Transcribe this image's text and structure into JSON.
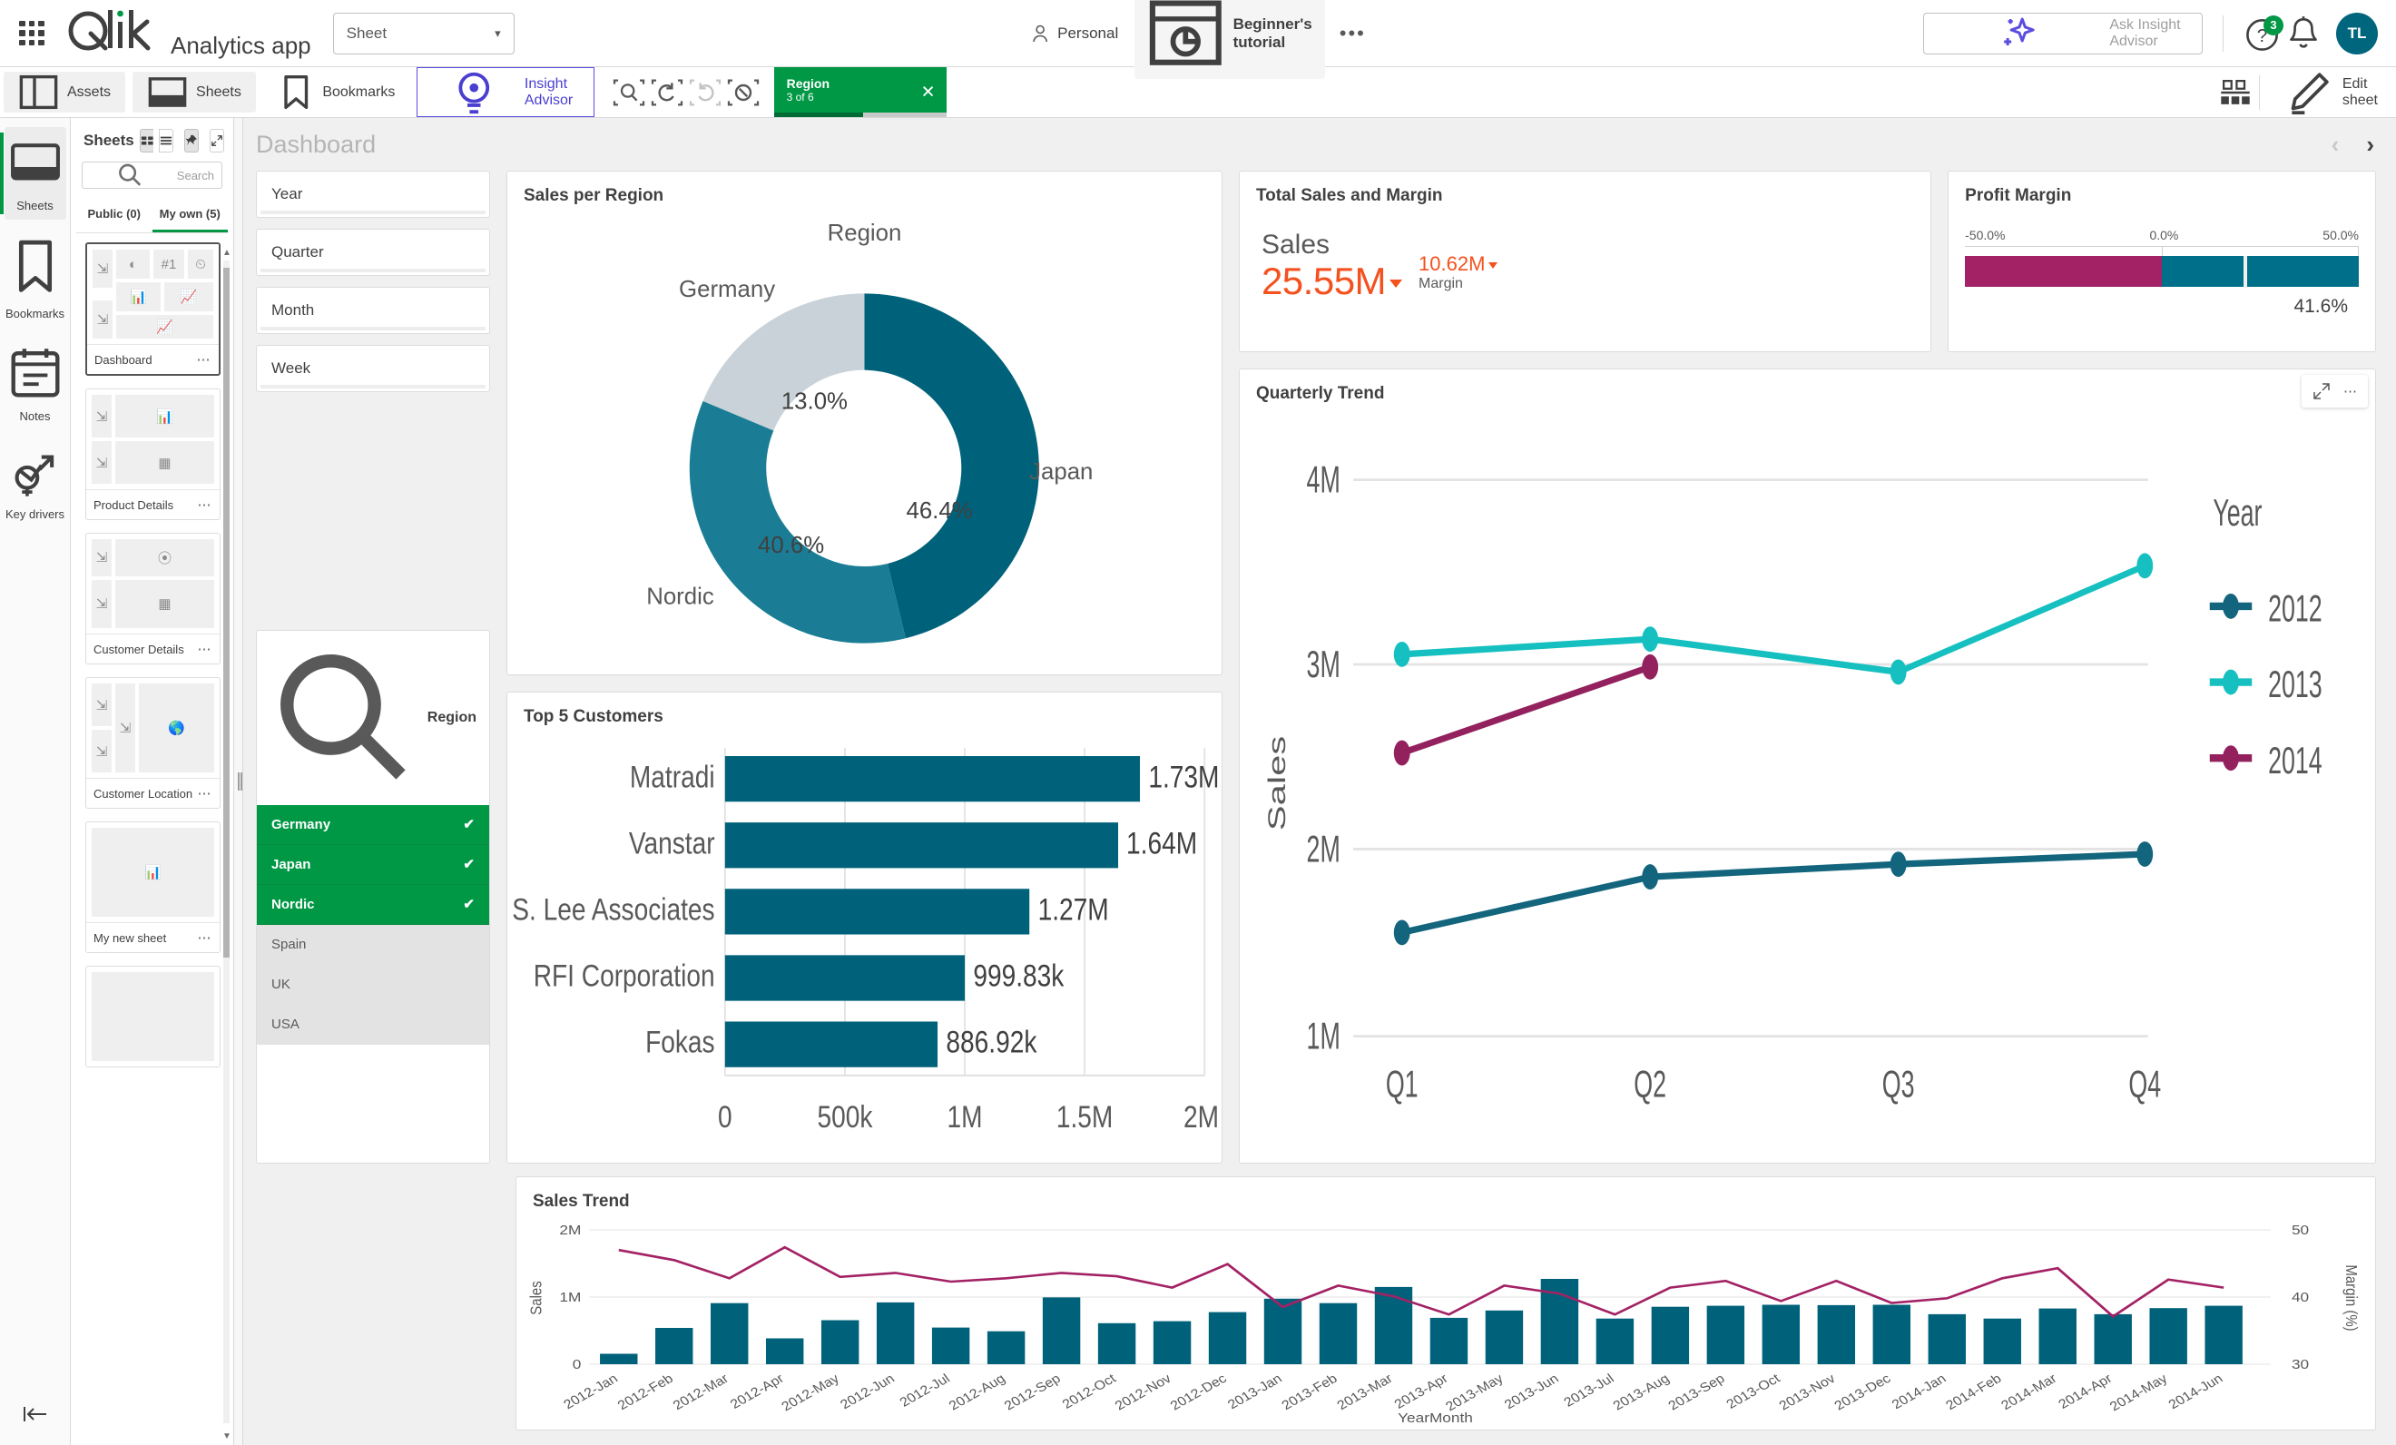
{
  "topbar": {
    "waffle_icon": "apps-grid-icon",
    "logo_text": "Qlik",
    "app_title": "Analytics app",
    "sheet_selector_value": "Sheet",
    "space_label": "Personal",
    "app_name": "Beginner's tutorial",
    "more_label": "•••",
    "insight_placeholder": "Ask Insight Advisor",
    "help_badge": "3",
    "avatar_initials": "TL"
  },
  "toolbar": {
    "assets": "Assets",
    "sheets": "Sheets",
    "bookmarks": "Bookmarks",
    "insight_advisor": "Insight Advisor",
    "selection_chip": {
      "field": "Region",
      "state": "3 of 6",
      "close": "✕"
    },
    "edit_sheet": "Edit sheet"
  },
  "rail": {
    "items": [
      {
        "label": "Sheets",
        "icon": "sheet-icon",
        "active": true
      },
      {
        "label": "Bookmarks",
        "icon": "bookmark-icon",
        "active": false
      },
      {
        "label": "Notes",
        "icon": "notes-icon",
        "active": false
      },
      {
        "label": "Key drivers",
        "icon": "key-drivers-icon",
        "active": false
      }
    ],
    "collapse_label": "collapse-panel-icon"
  },
  "sheets_panel": {
    "title": "Sheets",
    "search_placeholder": "Search",
    "tabs": [
      {
        "label": "Public (0)",
        "active": false
      },
      {
        "label": "My own (5)",
        "active": true
      }
    ],
    "sheets": [
      {
        "name": "Dashboard",
        "selected": true
      },
      {
        "name": "Product Details",
        "selected": false
      },
      {
        "name": "Customer Details",
        "selected": false
      },
      {
        "name": "Customer Location",
        "selected": false
      },
      {
        "name": "My new sheet",
        "selected": false
      }
    ]
  },
  "sheet": {
    "name": "Dashboard",
    "prev_arrow": "‹",
    "next_arrow": "›"
  },
  "filters": {
    "items": [
      "Year",
      "Quarter",
      "Month",
      "Week"
    ],
    "listbox": {
      "field": "Region",
      "values": [
        {
          "label": "Germany",
          "selected": true,
          "check": "✔"
        },
        {
          "label": "Japan",
          "selected": true,
          "check": "✔"
        },
        {
          "label": "Nordic",
          "selected": true,
          "check": "✔"
        },
        {
          "label": "Spain",
          "selected": false,
          "check": ""
        },
        {
          "label": "UK",
          "selected": false,
          "check": ""
        },
        {
          "label": "USA",
          "selected": false,
          "check": ""
        }
      ]
    }
  },
  "cards": {
    "sales_per_region": "Sales per Region",
    "total_sales_margin": "Total Sales and Margin",
    "profit_margin": "Profit Margin",
    "quarterly_trend": "Quarterly Trend",
    "top5": "Top 5 Customers",
    "sales_trend": "Sales Trend"
  },
  "kpi": {
    "title": "Total Sales and Margin",
    "measure_label": "Sales",
    "value": "25.55M",
    "secondary_value": "10.62M",
    "secondary_label": "Margin"
  },
  "gauge": {
    "title": "Profit Margin",
    "min_label": "-50.0%",
    "mid_label": "0.0%",
    "max_label": "50.0%",
    "value_label": "41.6%",
    "value": 41.6,
    "min": -50,
    "max": 50,
    "neg_color": "#a32265",
    "pos_color": "#00708a"
  },
  "chart_data": [
    {
      "id": "sales_per_region",
      "type": "pie",
      "title": "Sales per Region",
      "legend_title": "Region",
      "labels": [
        "Japan",
        "Nordic",
        "Germany"
      ],
      "values": [
        46.4,
        40.6,
        13.0
      ],
      "value_labels": [
        "46.4%",
        "40.6%",
        "13.0%"
      ],
      "colors": [
        "#00627a",
        "#1a7d95",
        "#c8d2d8"
      ],
      "donut": true
    },
    {
      "id": "top_5_customers",
      "type": "bar",
      "title": "Top 5 Customers",
      "orientation": "horizontal",
      "categories": [
        "Matradi",
        "Vanstar",
        "J. S. Lee Associates",
        "RFI Corporation",
        "Fokas"
      ],
      "values": [
        1730000,
        1640000,
        1270000,
        999830,
        886920
      ],
      "data_labels": [
        "1.73M",
        "1.64M",
        "1.27M",
        "999.83k",
        "886.92k"
      ],
      "xlim": [
        0,
        2000000
      ],
      "xticks": [
        0,
        500000,
        1000000,
        1500000,
        2000000
      ],
      "xtick_labels": [
        "0",
        "500k",
        "1M",
        "1.5M",
        "2M"
      ],
      "color": "#00627a"
    },
    {
      "id": "quarterly_trend",
      "type": "line",
      "title": "Quarterly Trend",
      "categories": [
        "Q1",
        "Q2",
        "Q3",
        "Q4"
      ],
      "ylabel": "Sales",
      "ylim": [
        1000000,
        4000000
      ],
      "yticks": [
        1000000,
        2000000,
        3000000,
        4000000
      ],
      "ytick_labels": [
        "1M",
        "2M",
        "3M",
        "4M"
      ],
      "legend_title": "Year",
      "legend_position": "right",
      "series": [
        {
          "name": "2012",
          "color": "#13657d",
          "values": [
            1560000,
            1860000,
            1930000,
            1985000
          ]
        },
        {
          "name": "2013",
          "color": "#16c0c0",
          "values": [
            3055000,
            3140000,
            2965000,
            3540000
          ]
        },
        {
          "name": "2014",
          "color": "#93215e",
          "values": [
            2530000,
            2990000,
            null,
            null
          ]
        }
      ]
    },
    {
      "id": "sales_trend",
      "type": "bar",
      "title": "Sales Trend",
      "xlabel": "YearMonth",
      "ylabel": "Sales",
      "y2label": "Margin (%)",
      "ylim": [
        0,
        2000000
      ],
      "yticks": [
        0,
        1000000,
        2000000
      ],
      "ytick_labels": [
        "0",
        "1M",
        "2M"
      ],
      "y2lim": [
        30,
        50
      ],
      "y2ticks": [
        30,
        40,
        50
      ],
      "y2tick_labels": [
        "30",
        "40",
        "50"
      ],
      "bar_color": "#00627a",
      "line_color": "#a32265",
      "categories": [
        "2012-Jan",
        "2012-Feb",
        "2012-Mar",
        "2012-Apr",
        "2012-May",
        "2012-Jun",
        "2012-Jul",
        "2012-Aug",
        "2012-Sep",
        "2012-Oct",
        "2012-Nov",
        "2012-Dec",
        "2013-Jan",
        "2013-Feb",
        "2013-Mar",
        "2013-Apr",
        "2013-May",
        "2013-Jun",
        "2013-Jul",
        "2013-Aug",
        "2013-Sep",
        "2013-Oct",
        "2013-Nov",
        "2013-Dec",
        "2014-Jan",
        "2014-Feb",
        "2014-Mar",
        "2014-Apr",
        "2014-May",
        "2014-Jun"
      ],
      "series": [
        {
          "name": "Sales",
          "type": "bar",
          "axis": "left",
          "values": [
            155000,
            540000,
            910000,
            385000,
            655000,
            920000,
            545000,
            490000,
            995000,
            610000,
            640000,
            775000,
            975000,
            910000,
            1150000,
            690000,
            800000,
            1270000,
            680000,
            855000,
            870000,
            885000,
            880000,
            885000,
            745000,
            680000,
            830000,
            745000,
            835000,
            870000
          ]
        },
        {
          "name": "Margin",
          "type": "line",
          "axis": "right",
          "values": [
            47.0,
            45.5,
            42.8,
            47.4,
            43.0,
            43.6,
            42.3,
            42.8,
            43.6,
            43.1,
            41.4,
            44.9,
            38.5,
            41.7,
            40.3,
            37.6,
            41.9,
            40.7,
            37.6,
            41.6,
            42.6,
            39.6,
            42.6,
            39.3,
            40.0,
            43.0,
            44.5,
            37.4,
            42.9,
            41.6
          ]
        }
      ]
    }
  ]
}
